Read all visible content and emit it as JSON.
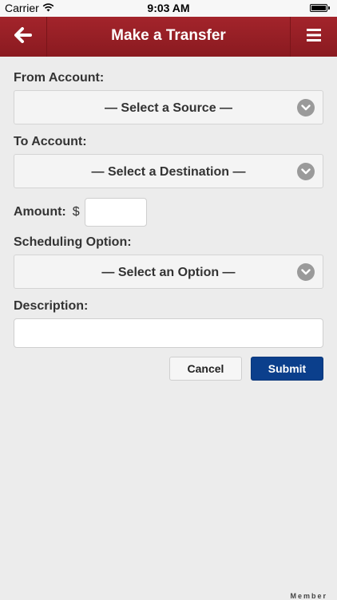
{
  "status_bar": {
    "carrier": "Carrier",
    "time": "9:03 AM"
  },
  "nav": {
    "title": "Make a Transfer",
    "back_icon": "back-arrow-icon",
    "menu_icon": "hamburger-menu-icon",
    "color": "#9a1f26"
  },
  "form": {
    "from_account": {
      "label": "From Account:",
      "value": "— Select a Source —"
    },
    "to_account": {
      "label": "To Account:",
      "value": "— Select a Destination —"
    },
    "amount": {
      "label": "Amount:",
      "currency_symbol": "$",
      "value": ""
    },
    "scheduling": {
      "label": "Scheduling Option:",
      "value": "— Select an Option —"
    },
    "description": {
      "label": "Description:",
      "value": ""
    }
  },
  "actions": {
    "cancel_label": "Cancel",
    "submit_label": "Submit",
    "submit_color": "#0b3f8c"
  },
  "footer": {
    "right_text": "Member"
  }
}
